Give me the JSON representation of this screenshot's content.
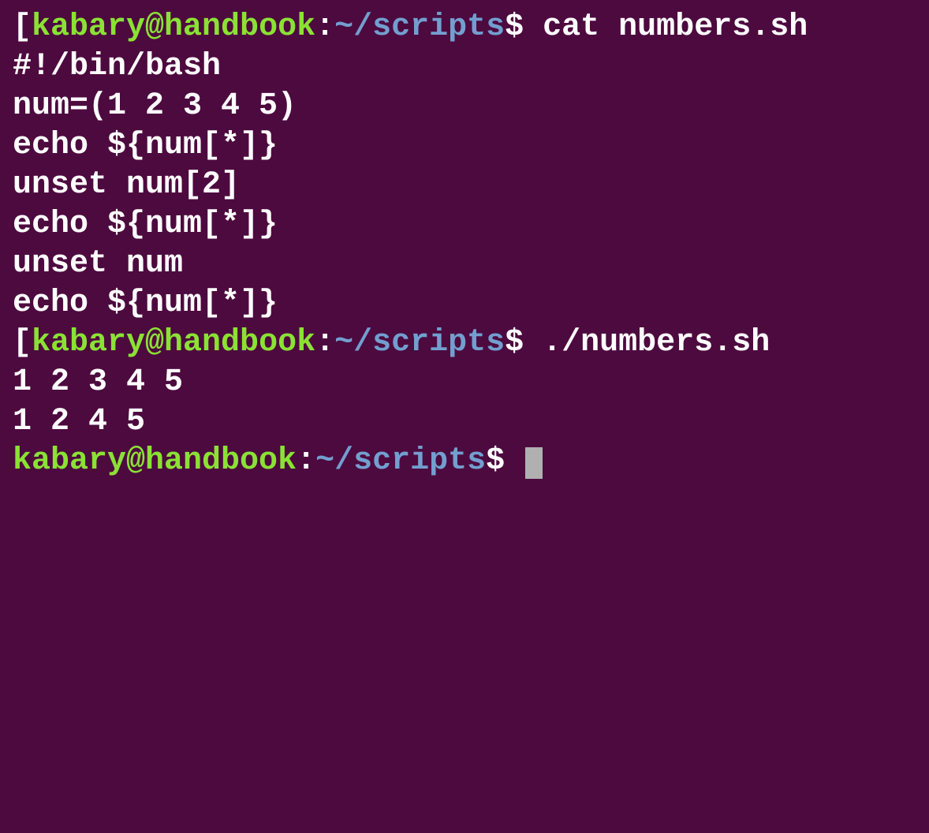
{
  "prompt1": {
    "bracket_open": "[",
    "user": "kabary@handbook",
    "colon": ":",
    "path": "~/scripts",
    "dollar": "$",
    "command": " cat numbers.sh"
  },
  "script": {
    "line1": "#!/bin/bash",
    "line2": "",
    "line3": "num=(1 2 3 4 5)",
    "line4": "",
    "line5": "echo ${num[*]}",
    "line6": "",
    "line7": "unset num[2]",
    "line8": "",
    "line9": "echo ${num[*]}",
    "line10": "",
    "line11": "unset num",
    "line12": "",
    "line13": "echo ${num[*]}"
  },
  "prompt2": {
    "bracket_open": "[",
    "user": "kabary@handbook",
    "colon": ":",
    "path": "~/scripts",
    "dollar": "$",
    "command": " ./numbers.sh"
  },
  "output": {
    "line1": "1 2 3 4 5",
    "line2": "1 2 4 5",
    "line3": ""
  },
  "prompt3": {
    "user": "kabary@handbook",
    "colon": ":",
    "path": "~/scripts",
    "dollar": "$",
    "command": " "
  }
}
